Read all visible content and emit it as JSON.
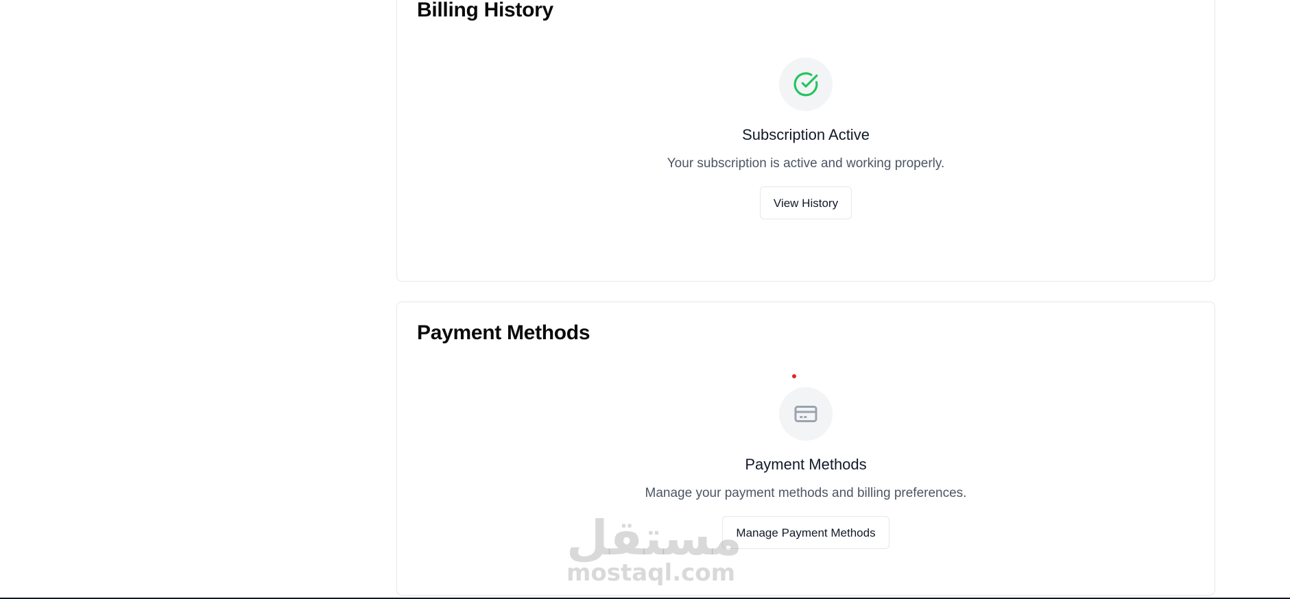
{
  "billing_history": {
    "title": "Billing History",
    "status_icon": "check-circle-icon",
    "status_color": "#22c55e",
    "empty_title": "Subscription Active",
    "empty_description": "Your subscription is active and working properly.",
    "button_label": "View History"
  },
  "payment_methods": {
    "title": "Payment Methods",
    "icon": "credit-card-icon",
    "empty_title": "Payment Methods",
    "empty_description": "Manage your payment methods and billing preferences.",
    "button_label": "Manage Payment Methods"
  },
  "watermark": {
    "arabic": "مستقل",
    "latin": "mostaql.com"
  },
  "colors": {
    "accent_green": "#22c55e",
    "muted_icon": "#9ca3af",
    "border": "#e5e7eb",
    "dot_red": "#dc2626"
  }
}
